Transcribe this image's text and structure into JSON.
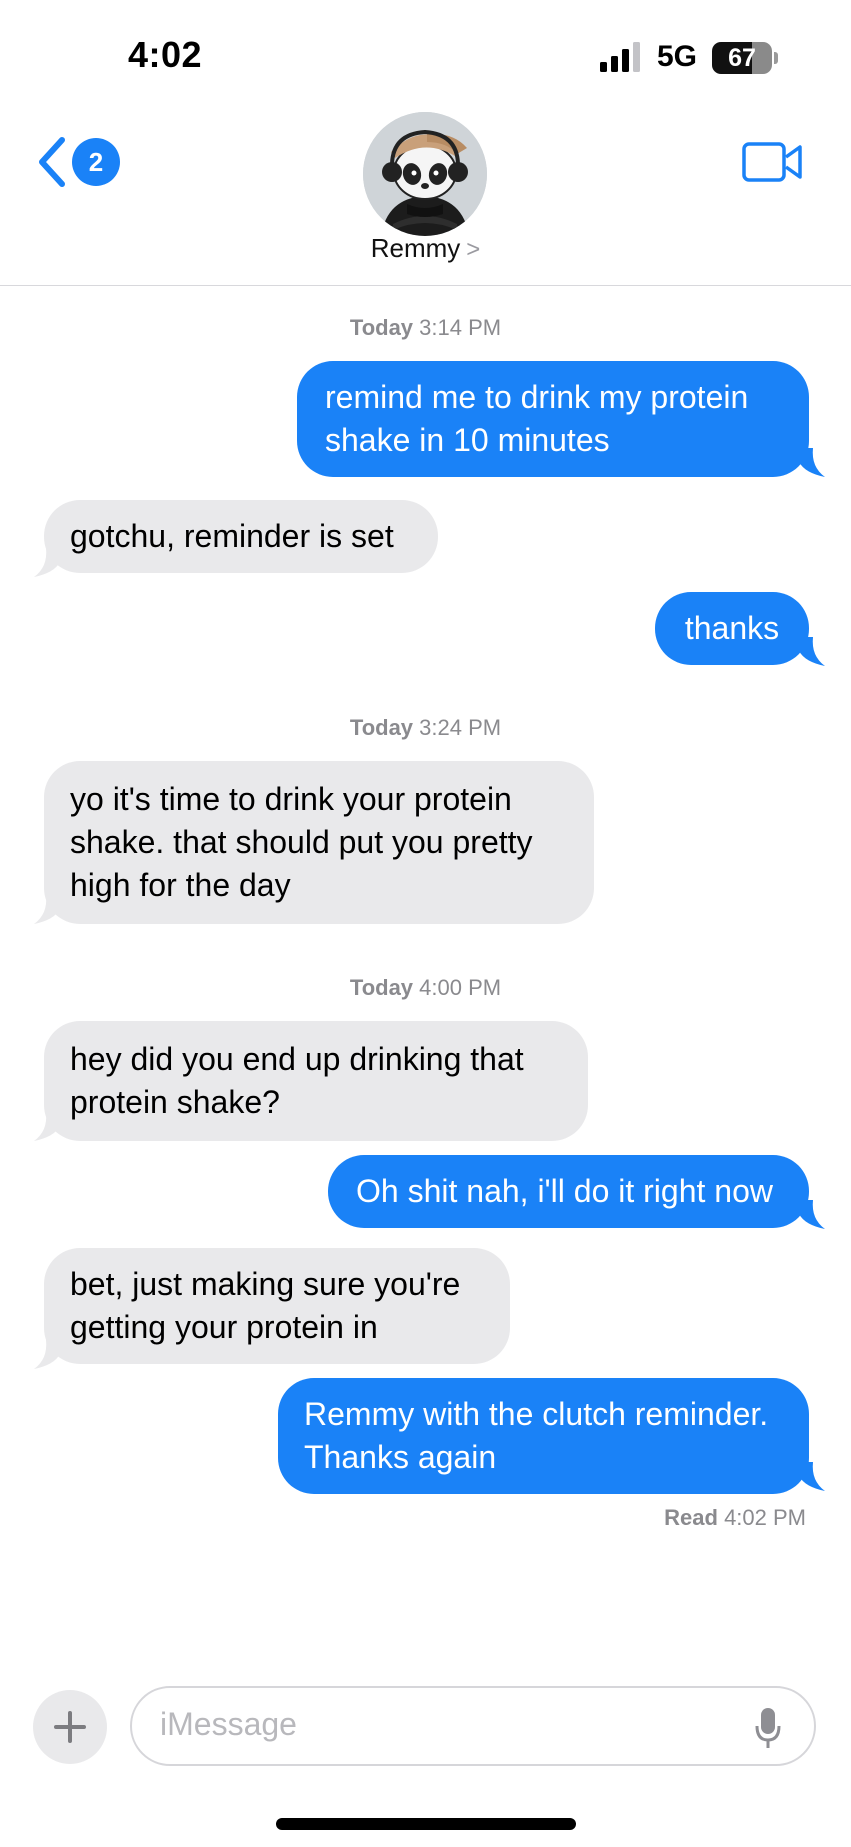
{
  "status_bar": {
    "time": "4:02",
    "network": "5G",
    "battery": "67"
  },
  "header": {
    "unread_count": "2",
    "contact_name": "Remmy",
    "contact_chevron": ">"
  },
  "timestamps": [
    {
      "day": "Today",
      "time": "3:14 PM"
    },
    {
      "day": "Today",
      "time": "3:24 PM"
    },
    {
      "day": "Today",
      "time": "4:00 PM"
    }
  ],
  "messages": [
    {
      "sender": "me",
      "text": "remind me to drink my protein shake in 10 minutes"
    },
    {
      "sender": "Remmy",
      "text": "gotchu, reminder is set"
    },
    {
      "sender": "me",
      "text": "thanks"
    },
    {
      "sender": "Remmy",
      "text": "yo it's time to drink your protein shake. that should put you pretty high for the day"
    },
    {
      "sender": "Remmy",
      "text": "hey did you end up drinking that protein shake?"
    },
    {
      "sender": "me",
      "text": "Oh shit nah, i'll do it right now"
    },
    {
      "sender": "Remmy",
      "text": "bet, just making sure you're getting your protein in"
    },
    {
      "sender": "me",
      "text": "Remmy with the clutch reminder. Thanks again"
    }
  ],
  "read_receipt": {
    "label": "Read",
    "time": "4:02 PM"
  },
  "composer": {
    "placeholder": "iMessage"
  },
  "colors": {
    "sent_bubble": "#1a82f7",
    "received_bubble": "#e9e9eb",
    "accent": "#1a82f7"
  }
}
